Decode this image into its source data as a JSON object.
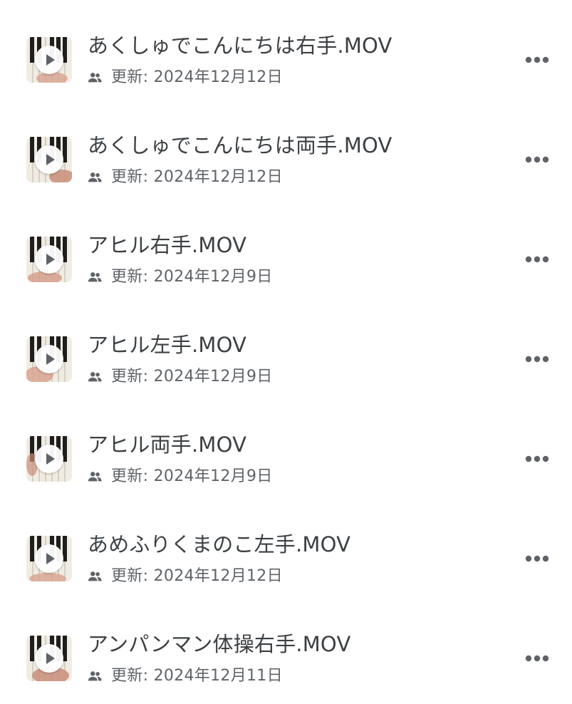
{
  "files": [
    {
      "name": "あくしゅでこんにちは右手.MOV",
      "shared_icon": "people-icon",
      "updated": "更新: 2024年12月12日",
      "thumbnail": "video-thumbnail-piano",
      "more_icon": "more-horizontal-icon"
    },
    {
      "name": "あくしゅでこんにちは両手.MOV",
      "shared_icon": "people-icon",
      "updated": "更新: 2024年12月12日",
      "thumbnail": "video-thumbnail-piano",
      "more_icon": "more-horizontal-icon"
    },
    {
      "name": "アヒル右手.MOV",
      "shared_icon": "people-icon",
      "updated": "更新: 2024年12月9日",
      "thumbnail": "video-thumbnail-piano",
      "more_icon": "more-horizontal-icon"
    },
    {
      "name": "アヒル左手.MOV",
      "shared_icon": "people-icon",
      "updated": "更新: 2024年12月9日",
      "thumbnail": "video-thumbnail-piano",
      "more_icon": "more-horizontal-icon"
    },
    {
      "name": "アヒル両手.MOV",
      "shared_icon": "people-icon",
      "updated": "更新: 2024年12月9日",
      "thumbnail": "video-thumbnail-piano",
      "more_icon": "more-horizontal-icon"
    },
    {
      "name": "あめふりくまのこ左手.MOV",
      "shared_icon": "people-icon",
      "updated": "更新: 2024年12月12日",
      "thumbnail": "video-thumbnail-piano",
      "more_icon": "more-horizontal-icon"
    },
    {
      "name": "アンパンマン体操右手.MOV",
      "shared_icon": "people-icon",
      "updated": "更新: 2024年12月11日",
      "thumbnail": "video-thumbnail-piano",
      "more_icon": "more-horizontal-icon"
    }
  ],
  "colors": {
    "title": "#3c4043",
    "meta": "#5f6368",
    "icon": "#5f6368",
    "play": "#5f6368"
  }
}
